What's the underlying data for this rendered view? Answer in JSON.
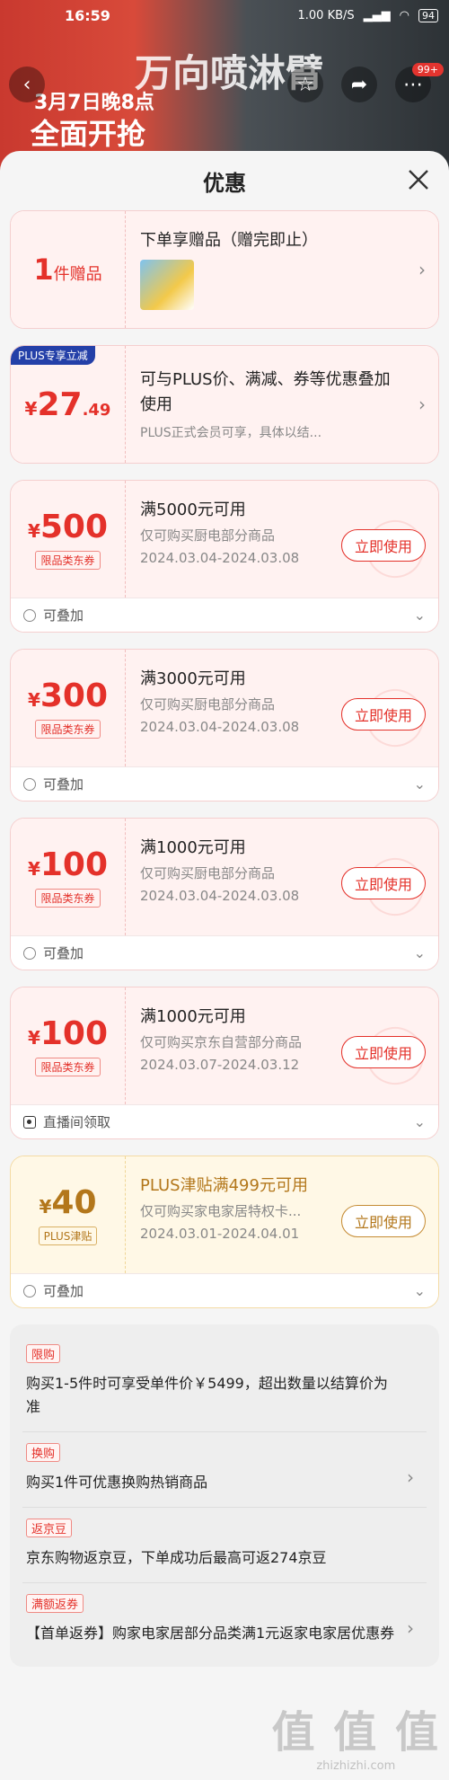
{
  "status_bar": {
    "time": "16:59",
    "network": "1.00 KB/S",
    "battery": "94"
  },
  "background": {
    "banner_line1": "3月7日晚8点",
    "banner_line2": "全面开抢",
    "banner_big": "万向喷淋臂",
    "badge": "99+"
  },
  "sheet": {
    "title": "优惠"
  },
  "gift_card": {
    "count_num": "1",
    "count_unit": "件赠品",
    "title": "下单享赠品（赠完即止）"
  },
  "plus_card": {
    "badge": "PLUS专享立减",
    "currency": "¥",
    "amount": "27",
    "decimal": ".49",
    "desc": "可与PLUS价、满减、券等优惠叠加使用",
    "note": "PLUS正式会员可享，具体以结..."
  },
  "coupons": [
    {
      "currency": "¥",
      "amount": "500",
      "tag": "限品类东券",
      "cond": "满5000元可用",
      "scope": "仅可购买厨电部分商品",
      "date": "2024.03.04-2024.03.08",
      "button": "立即使用",
      "foot": "可叠加",
      "foot_icon": "stack-icon"
    },
    {
      "currency": "¥",
      "amount": "300",
      "tag": "限品类东券",
      "cond": "满3000元可用",
      "scope": "仅可购买厨电部分商品",
      "date": "2024.03.04-2024.03.08",
      "button": "立即使用",
      "foot": "可叠加",
      "foot_icon": "stack-icon"
    },
    {
      "currency": "¥",
      "amount": "100",
      "tag": "限品类东券",
      "cond": "满1000元可用",
      "scope": "仅可购买厨电部分商品",
      "date": "2024.03.04-2024.03.08",
      "button": "立即使用",
      "foot": "可叠加",
      "foot_icon": "stack-icon"
    },
    {
      "currency": "¥",
      "amount": "100",
      "tag": "限品类东券",
      "cond": "满1000元可用",
      "scope": "仅可购买京东自营部分商品",
      "date": "2024.03.07-2024.03.12",
      "button": "立即使用",
      "foot": "直播间领取",
      "foot_icon": "live-icon"
    },
    {
      "currency": "¥",
      "amount": "40",
      "tag": "PLUS津贴",
      "cond": "PLUS津贴满499元可用",
      "scope": "仅可购买家电家居特权卡...",
      "date": "2024.03.01-2024.04.01",
      "button": "立即使用",
      "foot": "可叠加",
      "foot_icon": "stack-icon",
      "style": "gold"
    }
  ],
  "promotions": [
    {
      "tag": "限购",
      "text": "购买1-5件时可享受单件价￥5499，超出数量以结算价为准",
      "has_arrow": false
    },
    {
      "tag": "换购",
      "text": "购买1件可优惠换购热销商品",
      "has_arrow": true
    },
    {
      "tag": "返京豆",
      "text": "京东购物返京豆，下单成功后最高可返274京豆",
      "has_arrow": false
    },
    {
      "tag": "满额返券",
      "text": "【首单返券】购家电家居部分品类满1元返家电家居优惠券",
      "has_arrow": true
    }
  ],
  "watermark": {
    "big": "值 值 值",
    "small": "zhizhizhi.com"
  },
  "colors": {
    "accent": "#e4312a",
    "gold": "#b3771b",
    "plus_blue": "#2440a8"
  }
}
